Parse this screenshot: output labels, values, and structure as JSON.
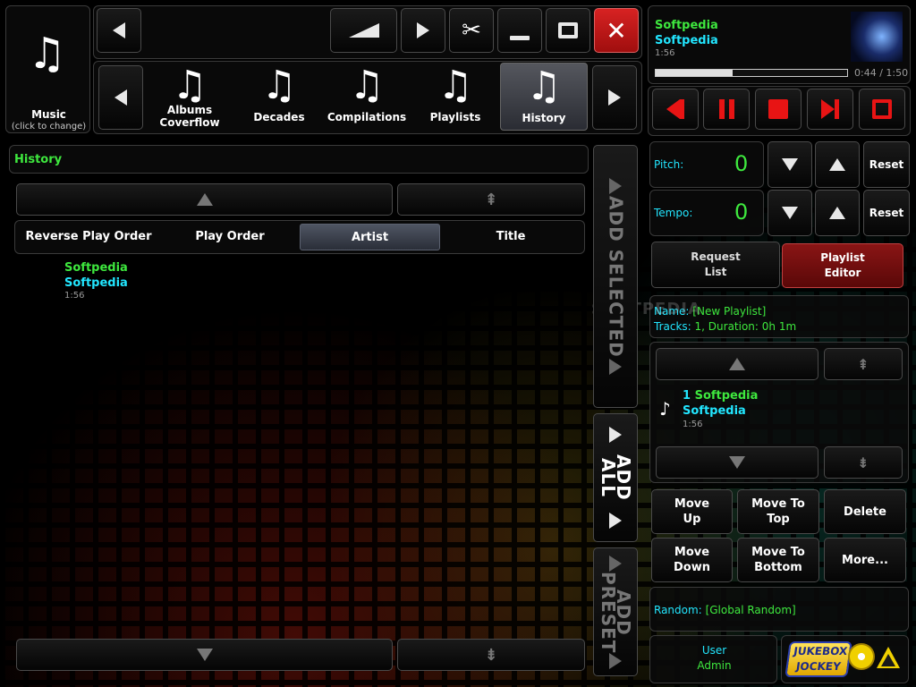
{
  "source": {
    "label": "Music",
    "hint": "(click to change)"
  },
  "tabs": [
    {
      "label": "Albums\nCoverflow"
    },
    {
      "label": "Decades"
    },
    {
      "label": "Compilations"
    },
    {
      "label": "Playlists"
    },
    {
      "label": "History"
    }
  ],
  "now_playing": {
    "title": "Softpedia",
    "artist": "Softpedia",
    "duration": "1:56",
    "position": "0:44 / 1:50",
    "progress": 0.4
  },
  "pitch": {
    "label": "Pitch:",
    "value": "0",
    "reset": "Reset"
  },
  "tempo": {
    "label": "Tempo:",
    "value": "0",
    "reset": "Reset"
  },
  "mode": {
    "request": "Request\nList",
    "editor": "Playlist\nEditor"
  },
  "playlist": {
    "name_label": "Name:",
    "name_value": "[New Playlist]",
    "tracks_label": "Tracks:",
    "tracks_value": "1, Duration: 0h 1m",
    "items": [
      {
        "num": "1",
        "title": "Softpedia",
        "artist": "Softpedia",
        "duration": "1:56"
      }
    ]
  },
  "actions": {
    "move_up": "Move\nUp",
    "move_top": "Move To\nTop",
    "delete": "Delete",
    "move_down": "Move\nDown",
    "move_bottom": "Move To\nBottom",
    "more": "More..."
  },
  "random": {
    "label": "Random:",
    "value": "[Global Random]"
  },
  "user": {
    "label": "User",
    "name": "Admin"
  },
  "logo": {
    "line1": "JUKEBOX",
    "line2": "JOCKEY"
  },
  "history": {
    "header": "History",
    "sort": [
      "Reverse Play Order",
      "Play Order",
      "Artist",
      "Title"
    ],
    "selected_sort": "Artist",
    "items": [
      {
        "title": "Softpedia",
        "artist": "Softpedia",
        "duration": "1:56"
      }
    ]
  },
  "side": {
    "add_selected": "ADD SELECTED",
    "add_all": "ADD ALL",
    "add_preset": "ADD PRESET"
  },
  "watermark": "SOFTPEDIA",
  "colors": {
    "accent_green": "#3ee83e",
    "accent_cyan": "#22e6ff",
    "close_red": "#c61a1a",
    "transport_red": "#e81414"
  }
}
